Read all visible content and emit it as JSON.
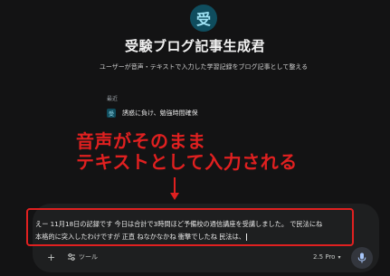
{
  "app": {
    "avatar_char": "受",
    "title": "受験ブログ記事生成君",
    "subtitle": "ユーザーが音声・テキストで入力した学習記録をブログ記事として整える"
  },
  "recent": {
    "label": "最近",
    "items": [
      {
        "icon_char": "受",
        "label": "誘惑に負け、勉強時間確保"
      }
    ]
  },
  "annotation": {
    "line1": "音声がそのまま",
    "line2": "テキストとして入力される",
    "color": "#e02020"
  },
  "composer": {
    "line1": "えー 11月18日の記録です 今日は合計で3時間ほど予備校の通信講座を受講しました。 で民法にね",
    "line2": "本格的に突入したわけですが 正直 ねなかなかね 衝撃でしたね 民法は、",
    "add_label": "+",
    "tools_label": "ツール",
    "model_label": "2.5 Pro",
    "model_chevron": "▾"
  },
  "icons": {
    "add": "plus-icon",
    "tools": "tools-icon",
    "mic": "microphone-icon",
    "arrow": "arrow-down-icon"
  }
}
